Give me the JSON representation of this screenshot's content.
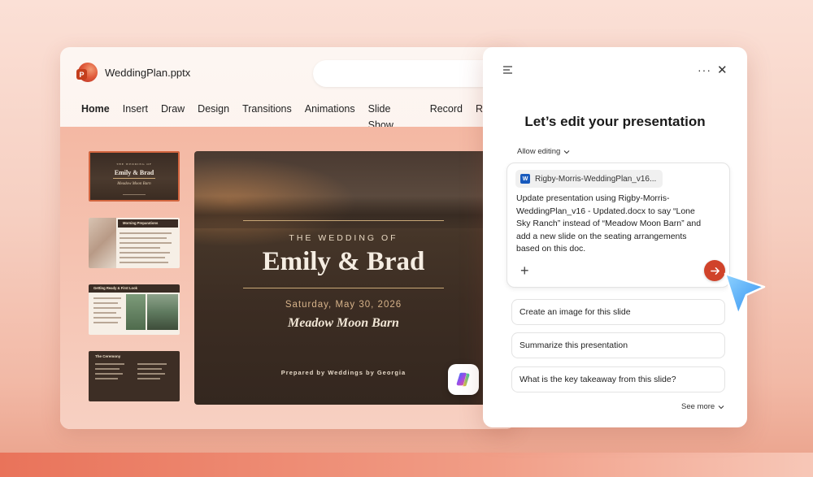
{
  "app": {
    "file_name": "WeddingPlan.pptx",
    "logo_letter": "P"
  },
  "ribbon": {
    "tabs": [
      "Home",
      "Insert",
      "Draw",
      "Design",
      "Transitions",
      "Animations",
      "Slide Show",
      "Record",
      "Review"
    ],
    "active_tab": "Home"
  },
  "thumbnails": {
    "slide1": {
      "label": "THE WEDDING OF",
      "names": "Emily & Brad",
      "venue": "Meadow Moon Barn"
    },
    "slide2": {
      "title": "Morning Preparations"
    },
    "slide3": {
      "title": "Getting Ready & First Look"
    },
    "slide4": {
      "title": "The Ceremony"
    }
  },
  "slide": {
    "label": "THE WEDDING OF",
    "names": "Emily & Brad",
    "date": "Saturday, May 30, 2026",
    "venue": "Meadow Moon Barn",
    "prepared_by": "Prepared by Weddings by Georgia"
  },
  "copilot": {
    "heading": "Let’s edit your presentation",
    "allow_editing": "Allow editing",
    "attachment": "Rigby-Morris-WeddingPlan_v16...",
    "prompt": "Update presentation using Rigby-Morris-WeddingPlan_v16 - Updated.docx to say “Lone Sky Ranch” instead of “Meadow Moon Barn” and add a new slide on the seating arrangements based on this doc.",
    "suggestions": [
      "Create an image for this slide",
      "Summarize this presentation",
      "What is the key takeaway from this slide?"
    ],
    "see_more": "See more"
  },
  "colors": {
    "accent": "#d0432a",
    "slide_bg": "#3c2d23",
    "gold": "#c9a877",
    "word_blue": "#185abd"
  },
  "icons": [
    "hamburger-menu-icon",
    "more-options-icon",
    "close-icon",
    "chevron-down-icon",
    "word-doc-icon",
    "plus-icon",
    "send-arrow-icon",
    "copilot-icon",
    "cursor-pointer-icon"
  ]
}
